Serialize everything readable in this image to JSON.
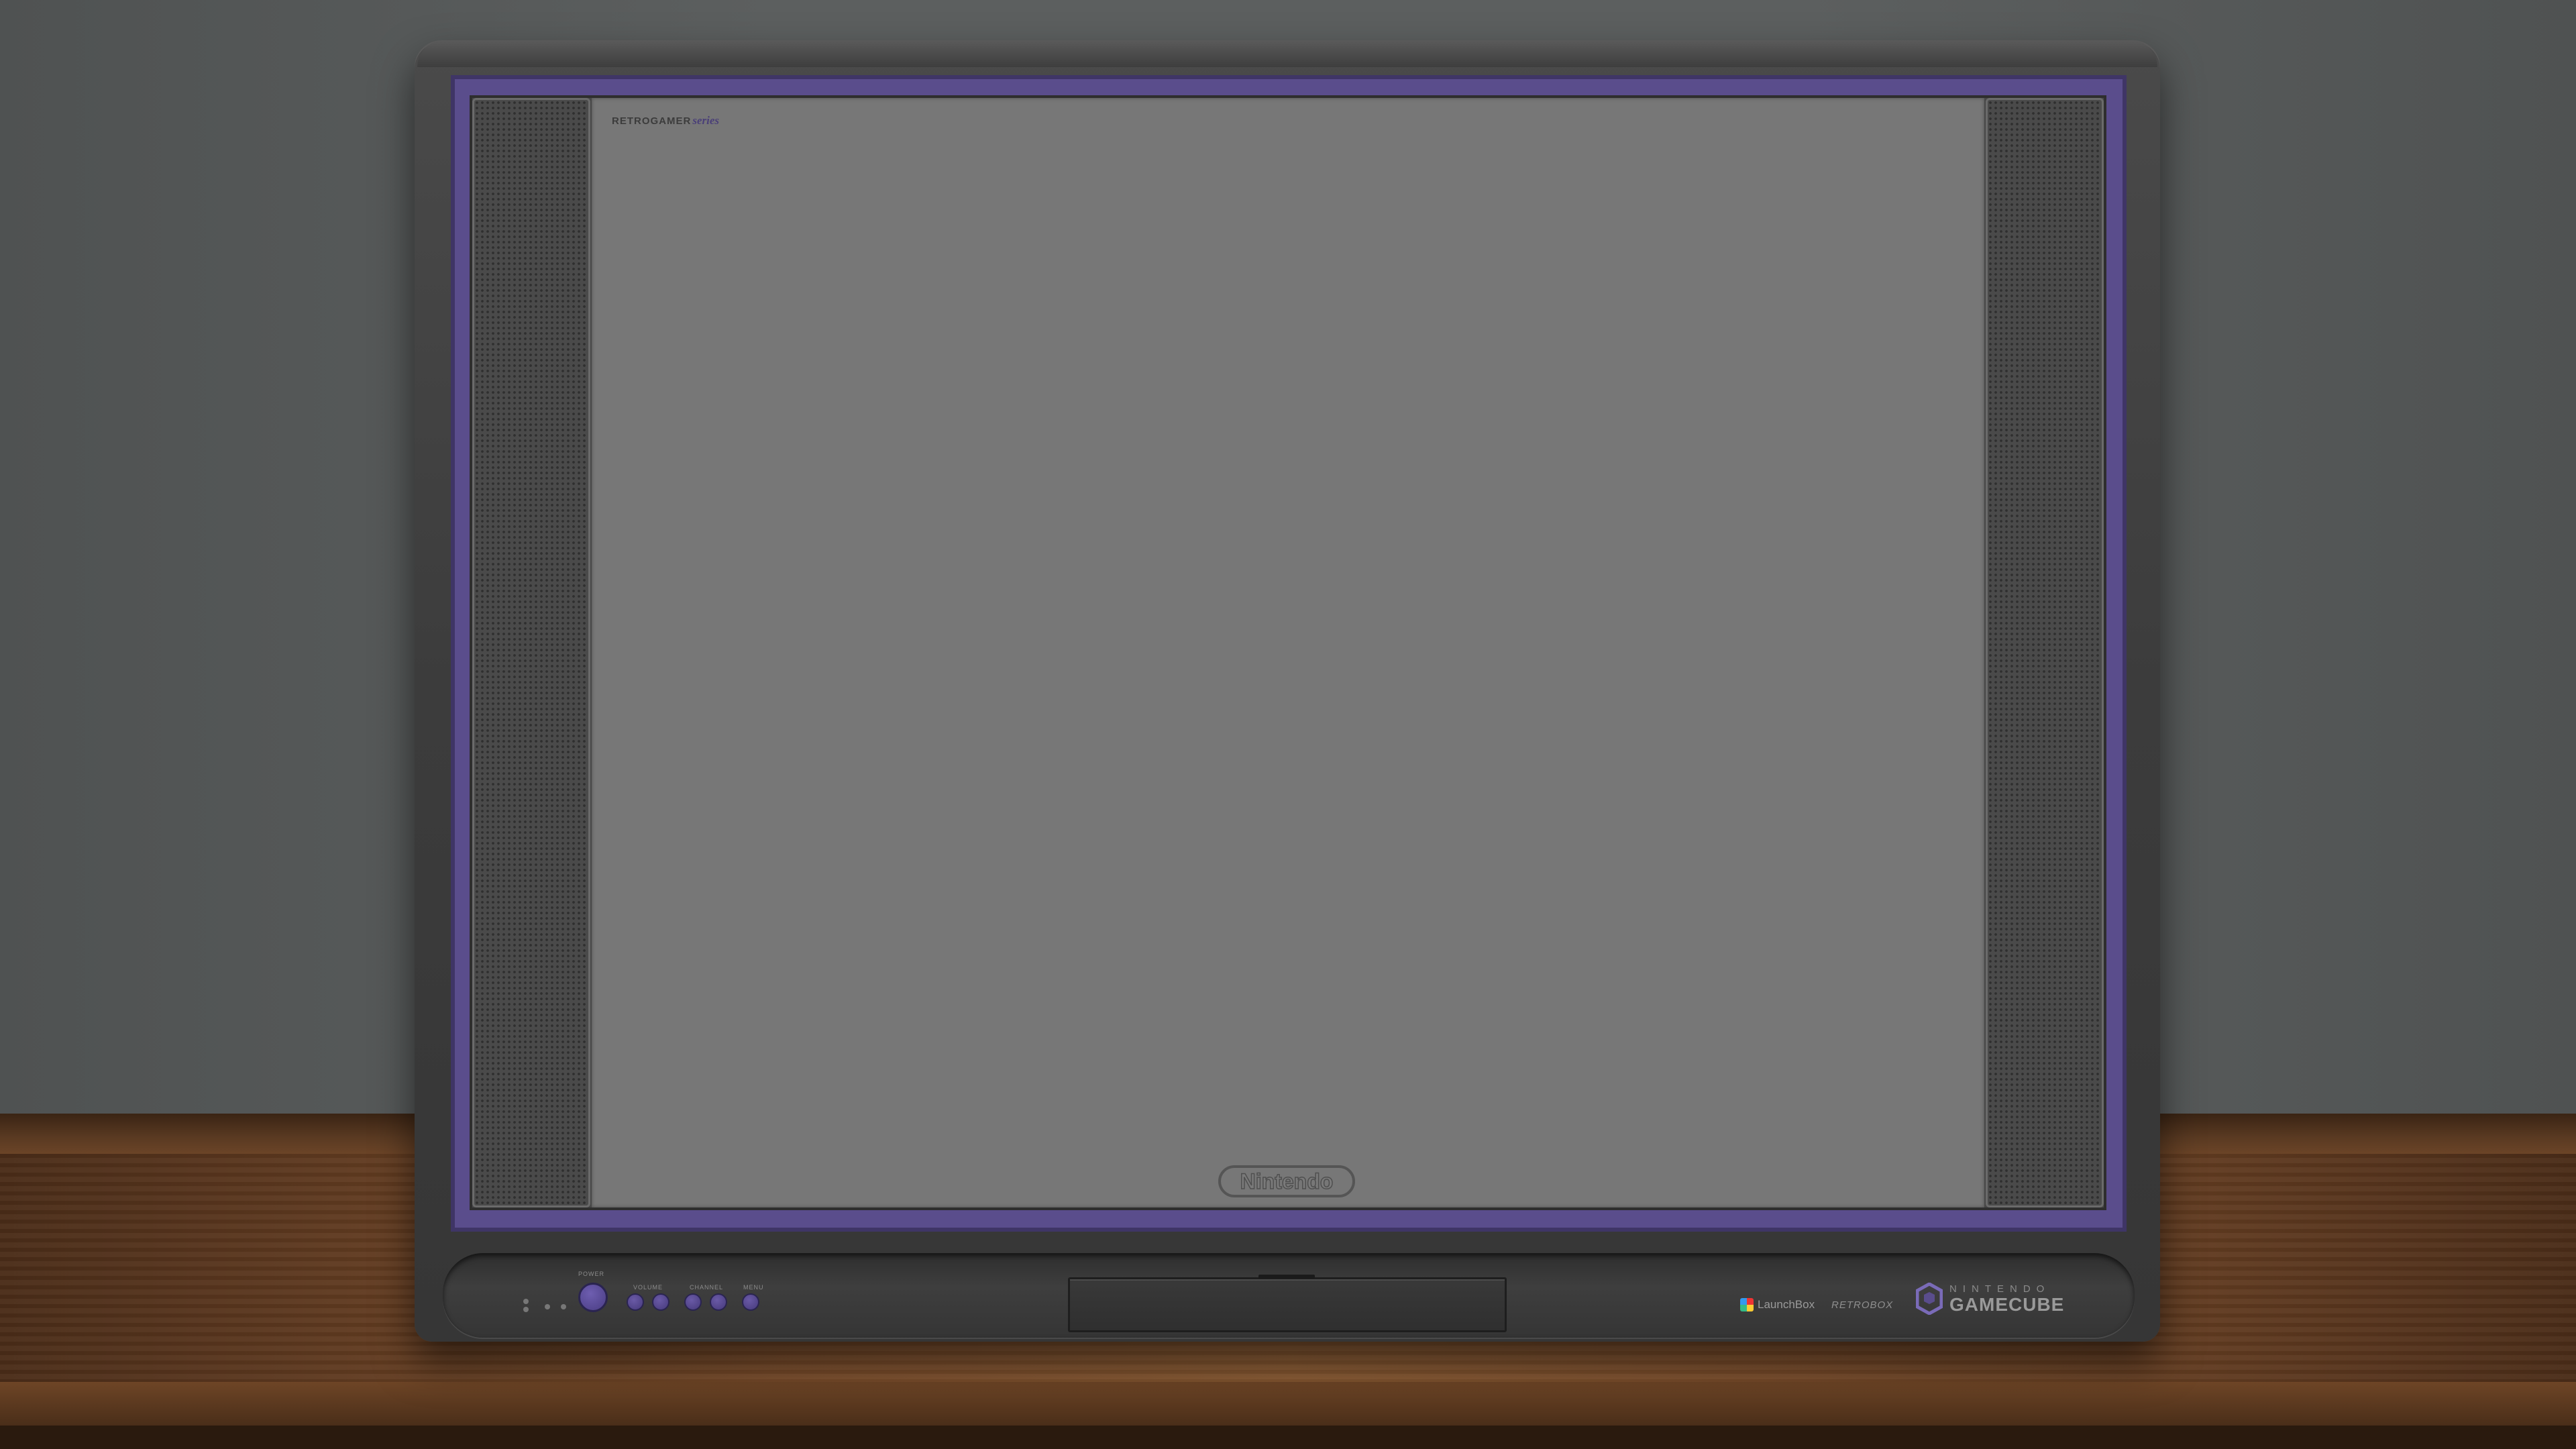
{
  "screen": {
    "corner_brand_main": "RETROGAMER",
    "corner_brand_accent": "series",
    "bottom_logo": "Nintendo"
  },
  "panel": {
    "power_label": "POWER",
    "volume_label": "VOLUME",
    "channel_label": "CHANNEL",
    "menu_label": "MENU",
    "launchbox_label": "LaunchBox",
    "retro_label": "RETROBOX",
    "brand_small": "NINTENDO",
    "brand_large": "GAMECUBE"
  },
  "colors": {
    "bezel_accent": "#5a4d8c",
    "wall": "#5c5f5f",
    "screen": "#777777",
    "shelf": "#7a4c2a"
  },
  "icons": {
    "power": "power-button-icon",
    "gamecube": "gamecube-cube-icon",
    "launchbox": "launchbox-logo-icon"
  }
}
